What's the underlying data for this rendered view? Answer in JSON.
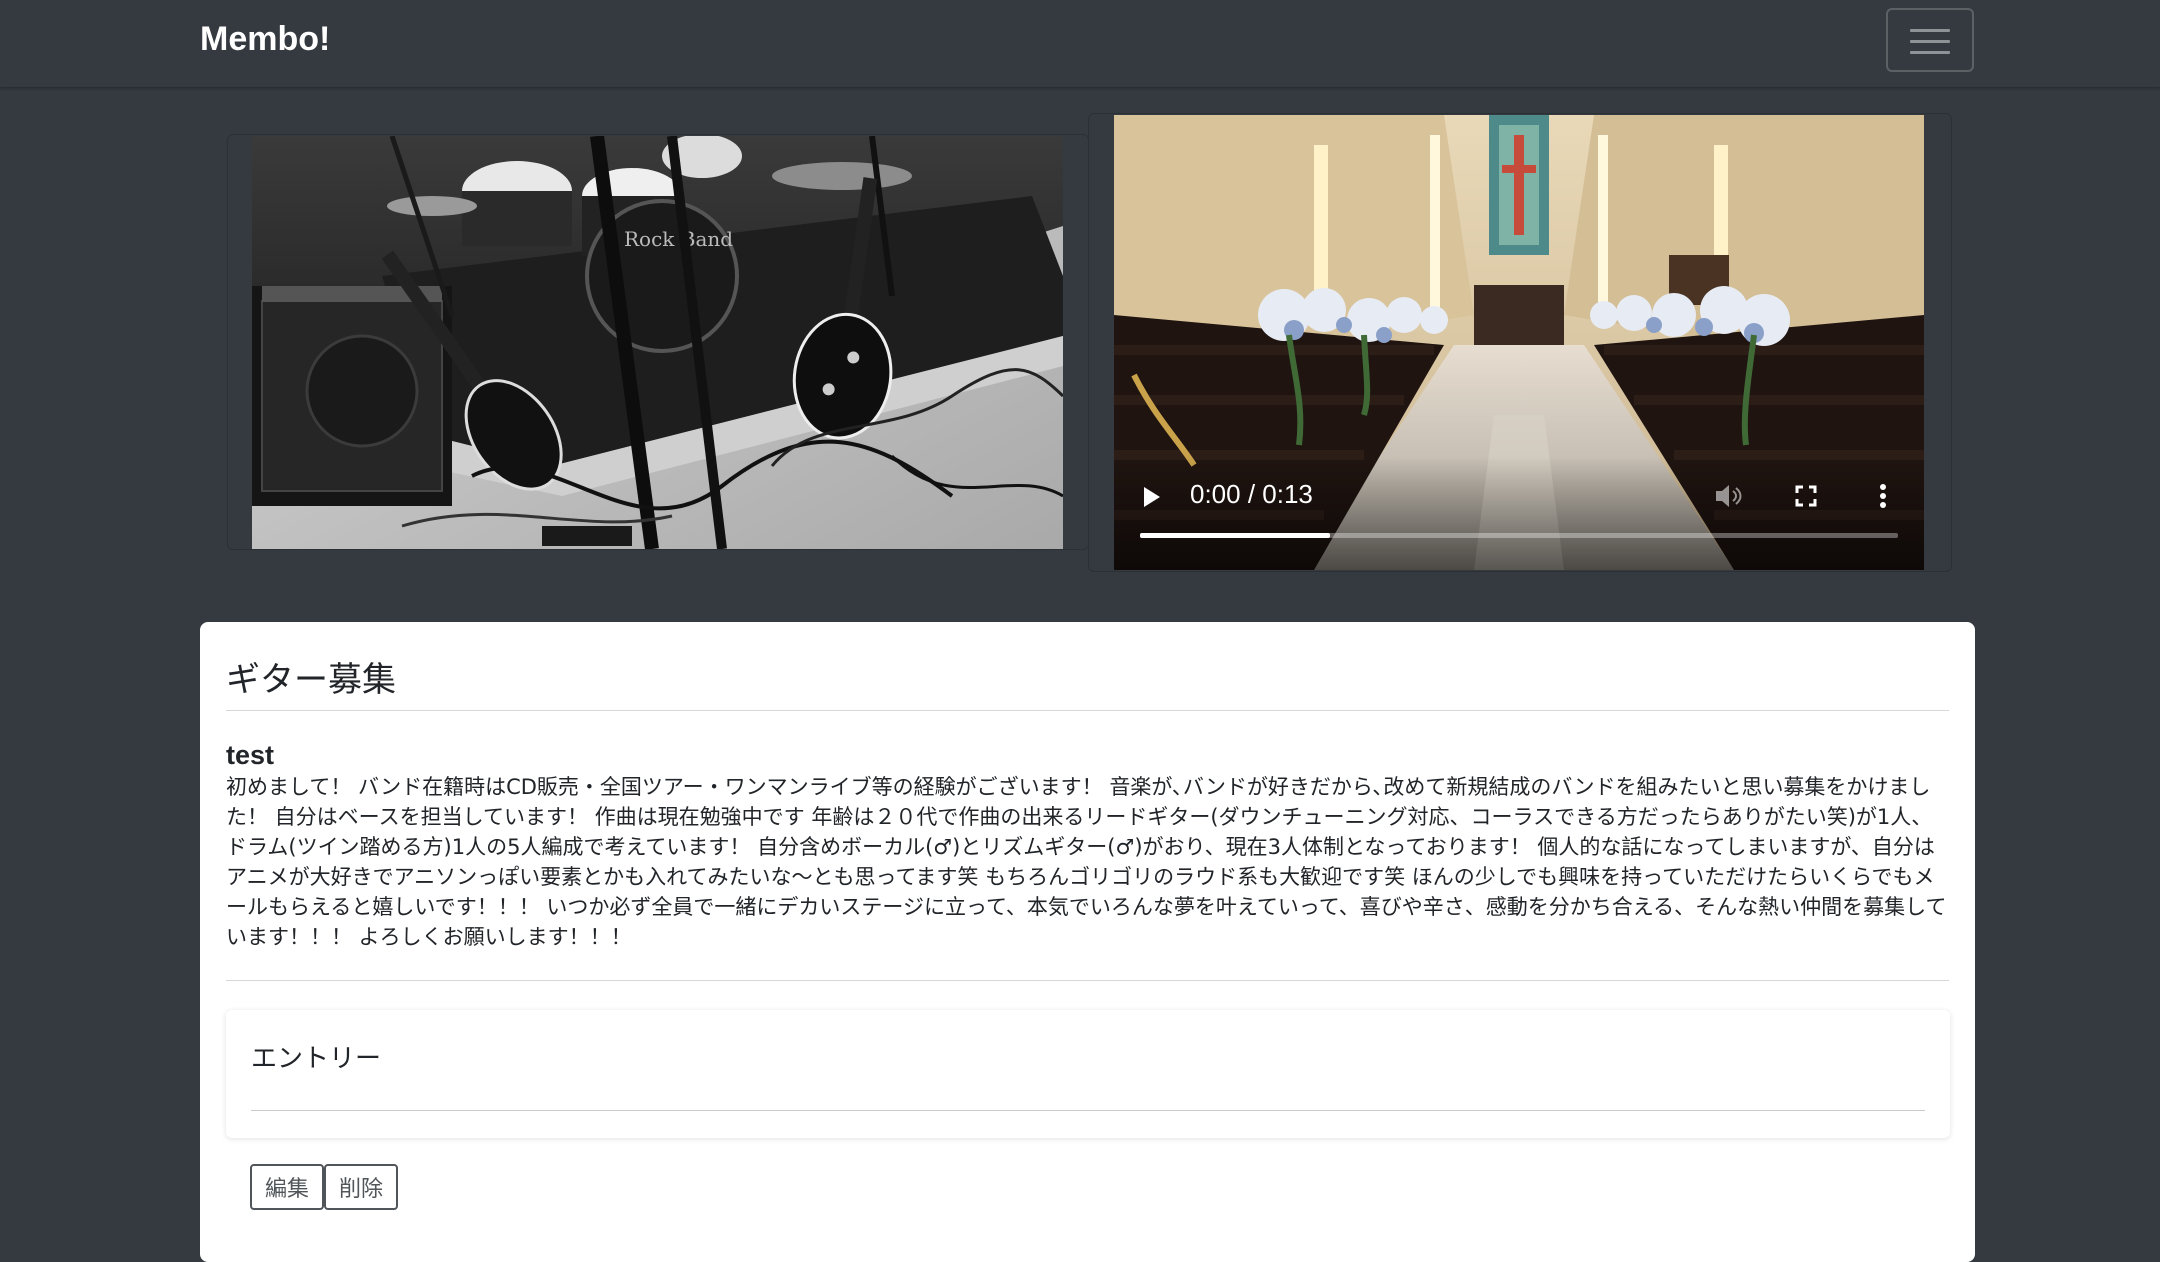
{
  "navbar": {
    "brand": "Membo!",
    "menu_icon": "hamburger-menu-icon"
  },
  "media": {
    "image_alt": "stage with drums, amps and guitars (black and white)",
    "video": {
      "current_time": "0:00",
      "duration": "0:13",
      "time_display": "0:00 / 0:13",
      "progress_fraction": 0.25,
      "icons": [
        "play-icon",
        "mute-icon",
        "fullscreen-icon",
        "more-options-icon"
      ]
    }
  },
  "post": {
    "title": "ギター募集",
    "subtitle": "test",
    "body": "初めまして！ バンド在籍時はCD販売・全国ツアー・ワンマンライブ等の経験がございます！ 音楽が､バンドが好きだから､改めて新規結成のバンドを組みたいと思い募集をかけました！ 自分はベースを担当しています！ 作曲は現在勉強中です 年齢は２０代で作曲の出来るリードギター(ダウンチューニング対応、コーラスできる方だったらありがたい笑)が1人、ドラム(ツイン踏める方)1人の5人編成で考えています！ 自分含めボーカル(♂)とリズムギター(♂)がおり、現在3人体制となっております！ 個人的な話になってしまいますが、自分はアニメが大好きでアニソンっぽい要素とかも入れてみたいな〜とも思ってます笑 もちろんゴリゴリのラウド系も大歓迎です笑 ほんの少しでも興味を持っていただけたらいくらでもメールもらえると嬉しいです！！！ いつか必ず全員で一緒にデカいステージに立って、本気でいろんな夢を叶えていって、喜びや辛さ、感動を分かち合える、そんな熱い仲間を募集しています！！！ よろしくお願いします！！！"
  },
  "entry": {
    "title": "エントリー"
  },
  "actions": {
    "edit_label": "編集",
    "delete_label": "削除"
  }
}
